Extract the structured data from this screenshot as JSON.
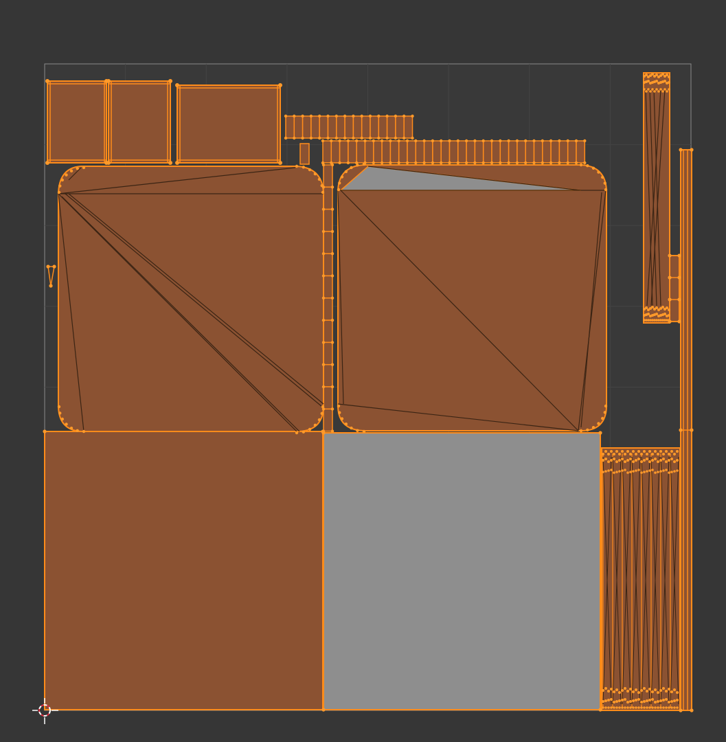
{
  "app": {
    "editor": "UV Editor"
  },
  "colors": {
    "background": "#363636",
    "uv_space_fill": "#393939",
    "uv_space_border": "#8a8a8a",
    "grid_line": "#444444",
    "selected_face_fill": "#8b5232",
    "unselected_face_fill": "#8e8e8e",
    "edge": "#ff8c1a",
    "dark_edge": "#3a2414",
    "vertex": "#ff9a2a"
  },
  "icons": {
    "cursor": "2d-cursor-icon"
  }
}
